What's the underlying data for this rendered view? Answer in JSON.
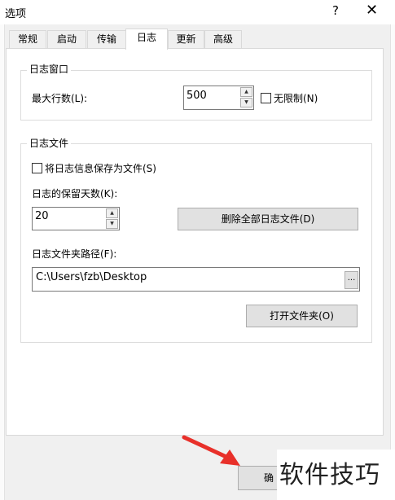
{
  "window": {
    "title": "选项",
    "help_glyph": "?",
    "close_glyph": "✕"
  },
  "tabs": [
    {
      "label": "常规"
    },
    {
      "label": "启动"
    },
    {
      "label": "传输"
    },
    {
      "label": "日志"
    },
    {
      "label": "更新"
    },
    {
      "label": "高级"
    }
  ],
  "active_tab": "日志",
  "log_window": {
    "group_label": "日志窗口",
    "max_lines_label": "最大行数(L):",
    "max_lines_value": "500",
    "unlimited_label": "无限制(N)",
    "unlimited_checked": false
  },
  "log_file": {
    "group_label": "日志文件",
    "save_to_file_label": "将日志信息保存为文件(S)",
    "save_to_file_checked": false,
    "retain_days_label": "日志的保留天数(K):",
    "retain_days_value": "20",
    "delete_all_button": "删除全部日志文件(D)",
    "folder_path_label": "日志文件夹路径(F):",
    "folder_path_value": "C:\\Users\\fzb\\Desktop",
    "browse_button": "...",
    "open_folder_button": "打开文件夹(O)"
  },
  "footer": {
    "ok_button_visible": "确"
  },
  "watermark": {
    "text": "软件技巧",
    "color": "#222222"
  },
  "annotation": {
    "arrow_color": "#e8302a"
  },
  "icons": {
    "spin_up": "▲",
    "spin_down": "▼"
  }
}
